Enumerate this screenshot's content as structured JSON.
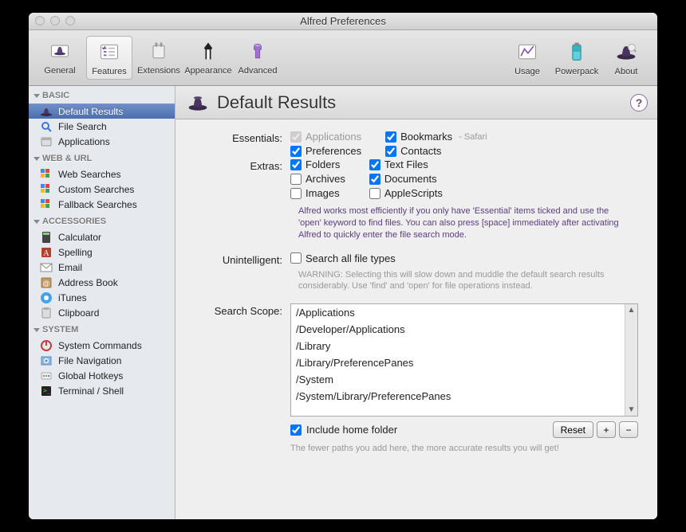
{
  "window": {
    "title": "Alfred Preferences"
  },
  "toolbar": {
    "left": [
      {
        "id": "general",
        "label": "General"
      },
      {
        "id": "features",
        "label": "Features",
        "selected": true
      },
      {
        "id": "extensions",
        "label": "Extensions"
      },
      {
        "id": "appearance",
        "label": "Appearance"
      },
      {
        "id": "advanced",
        "label": "Advanced"
      }
    ],
    "right": [
      {
        "id": "usage",
        "label": "Usage"
      },
      {
        "id": "powerpack",
        "label": "Powerpack"
      },
      {
        "id": "about",
        "label": "About"
      }
    ]
  },
  "sidebar": {
    "sections": [
      {
        "header": "BASIC",
        "items": [
          {
            "id": "default-results",
            "label": "Default Results",
            "selected": true
          },
          {
            "id": "file-search",
            "label": "File Search"
          },
          {
            "id": "applications",
            "label": "Applications"
          }
        ]
      },
      {
        "header": "WEB & URL",
        "items": [
          {
            "id": "web-searches",
            "label": "Web Searches"
          },
          {
            "id": "custom-searches",
            "label": "Custom Searches"
          },
          {
            "id": "fallback-searches",
            "label": "Fallback Searches"
          }
        ]
      },
      {
        "header": "ACCESSORIES",
        "items": [
          {
            "id": "calculator",
            "label": "Calculator"
          },
          {
            "id": "spelling",
            "label": "Spelling"
          },
          {
            "id": "email",
            "label": "Email"
          },
          {
            "id": "address-book",
            "label": "Address Book"
          },
          {
            "id": "itunes",
            "label": "iTunes"
          },
          {
            "id": "clipboard",
            "label": "Clipboard"
          }
        ]
      },
      {
        "header": "SYSTEM",
        "items": [
          {
            "id": "system-commands",
            "label": "System Commands"
          },
          {
            "id": "file-navigation",
            "label": "File Navigation"
          },
          {
            "id": "global-hotkeys",
            "label": "Global Hotkeys"
          },
          {
            "id": "terminal-shell",
            "label": "Terminal / Shell"
          }
        ]
      }
    ]
  },
  "main": {
    "title": "Default Results",
    "help": "?",
    "labels": {
      "essentials": "Essentials:",
      "extras": "Extras:",
      "unintelligent": "Unintelligent:",
      "search_scope": "Search Scope:"
    },
    "essentials": {
      "col1": [
        {
          "id": "applications",
          "label": "Applications",
          "checked": true,
          "disabled": true
        },
        {
          "id": "preferences",
          "label": "Preferences",
          "checked": true
        }
      ],
      "col2": [
        {
          "id": "bookmarks",
          "label": "Bookmarks",
          "checked": true,
          "sublabel": "- Safari"
        },
        {
          "id": "contacts",
          "label": "Contacts",
          "checked": true
        }
      ]
    },
    "extras": {
      "col1": [
        {
          "id": "folders",
          "label": "Folders",
          "checked": true
        },
        {
          "id": "archives",
          "label": "Archives",
          "checked": false
        },
        {
          "id": "images",
          "label": "Images",
          "checked": false
        }
      ],
      "col2": [
        {
          "id": "text-files",
          "label": "Text Files",
          "checked": true
        },
        {
          "id": "documents",
          "label": "Documents",
          "checked": true
        },
        {
          "id": "applescripts",
          "label": "AppleScripts",
          "checked": false
        }
      ]
    },
    "info_text": "Alfred works most efficiently if you only have 'Essential' items ticked and use the 'open' keyword to find files. You can also press [space] immediately after activating Alfred to quickly enter the file search mode.",
    "unintelligent": {
      "id": "search-all",
      "label": "Search all file types",
      "checked": false
    },
    "warn_text": "WARNING: Selecting this will slow down and muddle the default search results considerably. Use 'find' and 'open' for file operations instead.",
    "scope": {
      "paths": [
        "/Applications",
        "/Developer/Applications",
        "/Library",
        "/Library/PreferencePanes",
        "/System",
        "/System/Library/PreferencePanes"
      ],
      "include_home": {
        "label": "Include home folder",
        "checked": true
      },
      "buttons": {
        "reset": "Reset",
        "add": "+",
        "remove": "−"
      },
      "hint": "The fewer paths you add here, the more accurate results you will get!"
    }
  },
  "colors": {
    "accent_purple": "#5b3e7e",
    "selection_blue_top": "#7290c7",
    "selection_blue_bottom": "#4a6fad"
  }
}
